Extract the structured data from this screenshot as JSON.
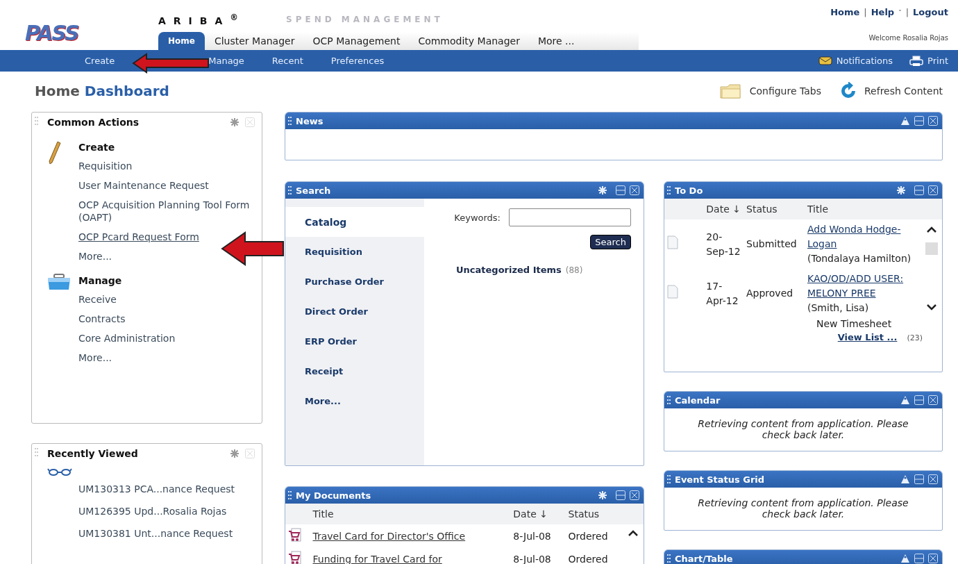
{
  "header": {
    "logo": "PASS",
    "brand": "ARIBA",
    "brand_mark": "®",
    "product": "SPEND MANAGEMENT",
    "top_links": [
      "Home",
      "Help",
      "Logout"
    ],
    "separator": "|",
    "help_caret": "˅",
    "welcome": "Welcome Rosalia Rojas",
    "tabs": [
      {
        "label": "Home",
        "selected": true
      },
      {
        "label": "Cluster Manager",
        "selected": false
      },
      {
        "label": "OCP Management",
        "selected": false
      },
      {
        "label": "Commodity Manager",
        "selected": false
      },
      {
        "label": "More ...",
        "selected": false
      }
    ],
    "subnav": [
      "Create",
      "Manage",
      "Recent",
      "Preferences"
    ],
    "notifications": "Notifications",
    "print": "Print"
  },
  "page_title": {
    "prefix": "Home",
    "main": "Dashboard"
  },
  "toolbar": {
    "configure": "Configure Tabs",
    "refresh": "Refresh Content"
  },
  "common_actions": {
    "title": "Common Actions",
    "groups": [
      {
        "kind": "create",
        "title": "Create",
        "items": [
          {
            "label": "Requisition",
            "hovered": false
          },
          {
            "label": "User Maintenance Request",
            "hovered": false
          },
          {
            "label": "OCP Acquisition Planning Tool Form (OAPT)",
            "hovered": false
          },
          {
            "label": "OCP Pcard Request Form",
            "hovered": true
          },
          {
            "label": "More...",
            "hovered": false
          }
        ]
      },
      {
        "kind": "manage",
        "title": "Manage",
        "items": [
          {
            "label": "Receive",
            "hovered": false
          },
          {
            "label": "Contracts",
            "hovered": false
          },
          {
            "label": "Core Administration",
            "hovered": false
          },
          {
            "label": "More...",
            "hovered": false
          }
        ]
      }
    ]
  },
  "recently_viewed": {
    "title": "Recently Viewed",
    "items": [
      "UM130313 PCA...nance Request",
      "UM126395 Upd...Rosalia Rojas",
      "UM130381 Unt...nance Request"
    ]
  },
  "news": {
    "title": "News"
  },
  "search": {
    "title": "Search",
    "categories": [
      {
        "label": "Catalog",
        "selected": true
      },
      {
        "label": "Requisition",
        "selected": false
      },
      {
        "label": "Purchase Order",
        "selected": false
      },
      {
        "label": "Direct Order",
        "selected": false
      },
      {
        "label": "ERP Order",
        "selected": false
      },
      {
        "label": "Receipt",
        "selected": false
      },
      {
        "label": "More...",
        "selected": false
      }
    ],
    "keywords_label": "Keywords:",
    "button": "Search",
    "result": "Uncategorized Items",
    "result_count": "(88)"
  },
  "my_documents": {
    "title": "My Documents",
    "columns": [
      "Title",
      "Date ↓",
      "Status"
    ],
    "rows": [
      {
        "title": "Travel Card for Director's Office",
        "date": "8-Jul-08",
        "status": "Ordered"
      },
      {
        "title": "Funding for Travel Card for",
        "date": "8-Jul-08",
        "status": "Ordered"
      }
    ]
  },
  "todo": {
    "title": "To Do",
    "columns": [
      "Date ↓",
      "Status",
      "Title"
    ],
    "rows": [
      {
        "date": "20-Sep-12",
        "status": "Submitted",
        "link": "Add Wonda Hodge-Logan",
        "person": "(Tondalaya Hamilton)"
      },
      {
        "date": "17-Apr-12",
        "status": "Approved",
        "link": "KAO/OD/ADD USER: MELONY PREE",
        "person": "(Smith, Lisa)"
      }
    ],
    "extra": "New Timesheet",
    "view_list": "View List ...",
    "count": "(23)"
  },
  "calendar": {
    "title": "Calendar",
    "message": "Retrieving content from application. Please check back later."
  },
  "event_status_grid": {
    "title": "Event Status Grid",
    "message": "Retrieving content from application. Please check back later."
  },
  "chart_table": {
    "title": "Chart/Table"
  }
}
